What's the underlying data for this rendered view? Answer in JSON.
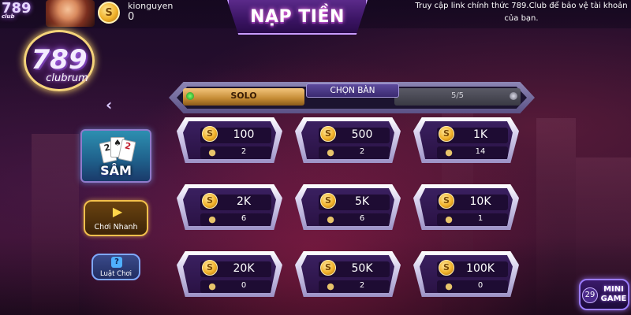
{
  "header": {
    "logo_small": "789",
    "logo_small_sub": "club",
    "username": "kionguyen",
    "balance": "0",
    "coin_symbol": "S",
    "title": "NẠP TIỀN",
    "notice": "Truy cập link chính thức 789.Club để bảo vệ tài khoản của bạn."
  },
  "brand": {
    "logo_number": "789",
    "logo_text": "clubrum"
  },
  "sidebar": {
    "back_icon": "chevron-left-icon",
    "game_card": {
      "label": "SÂM",
      "cards": [
        "2",
        "♠",
        "2"
      ]
    },
    "quick_play_label": "Chơi Nhanh",
    "rules_label": "Luật Chơi",
    "rules_icon_glyph": "?"
  },
  "mode_bar": {
    "solo_label": "SOLO",
    "choose_table_label": "CHỌN BÀN",
    "count_label": "5/5"
  },
  "tables": [
    {
      "bet": "100",
      "players": "2"
    },
    {
      "bet": "500",
      "players": "2"
    },
    {
      "bet": "1K",
      "players": "14"
    },
    {
      "bet": "2K",
      "players": "6"
    },
    {
      "bet": "5K",
      "players": "6"
    },
    {
      "bet": "10K",
      "players": "1"
    },
    {
      "bet": "20K",
      "players": "0"
    },
    {
      "bet": "50K",
      "players": "2"
    },
    {
      "bet": "100K",
      "players": "0"
    }
  ],
  "mini_game": {
    "count": "29",
    "label_line1": "MINI",
    "label_line2": "GAME"
  },
  "colors": {
    "accent_gold": "#f2c04c",
    "accent_purple": "#b46bff",
    "tile_inner": "#2a1244"
  }
}
